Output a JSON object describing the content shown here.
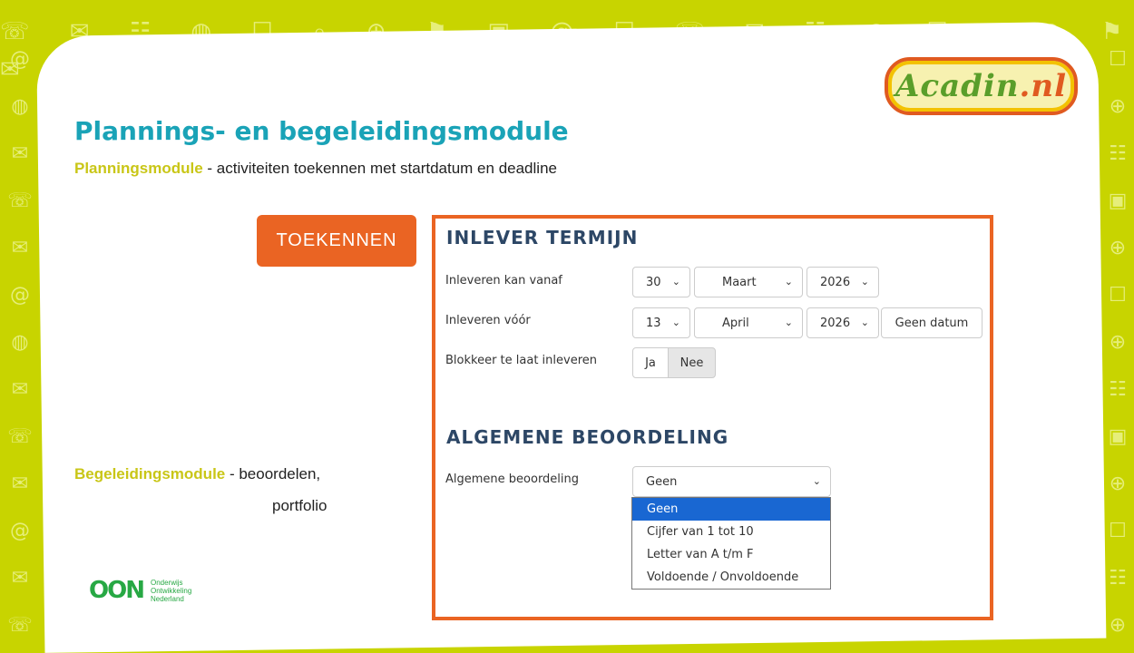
{
  "header": {
    "title": "Plannings- en begeleidingsmodule",
    "subtitle_highlight": "Planningsmodule",
    "subtitle_rest": " - activiteiten toekennen met startdatum en deadline"
  },
  "logo": {
    "main": "Acadin",
    "suffix": ".nl"
  },
  "assign_button": "TOEKENNEN",
  "panel": {
    "deadline_section": {
      "heading": "INLEVER TERMIJN",
      "start": {
        "label": "Inleveren kan vanaf",
        "day": "30",
        "month": "Maart",
        "year": "2026"
      },
      "end": {
        "label": "Inleveren vóór",
        "day": "13",
        "month": "April",
        "year": "2026",
        "no_date_label": "Geen datum"
      },
      "block": {
        "label": "Blokkeer te laat inleveren",
        "yes": "Ja",
        "no": "Nee",
        "selected": "Nee"
      }
    },
    "grading_section": {
      "heading": "ALGEMENE BEOORDELING",
      "label": "Algemene beoordeling",
      "selected": "Geen",
      "options": [
        "Geen",
        "Cijfer van 1 tot 10",
        "Letter van A t/m F",
        "Voldoende / Onvoldoende"
      ]
    }
  },
  "guidance": {
    "highlight": "Begeleidingsmodule",
    "rest": " - beoordelen,",
    "line2": "portfolio"
  },
  "footer_logo": {
    "mark": "OON",
    "lines": [
      "Onderwijs",
      "Ontwikkeling",
      "Nederland"
    ]
  },
  "colors": {
    "accent_orange": "#ea6423",
    "title_teal": "#1aa3b7",
    "highlight_yellow": "#c9c617",
    "background_lime": "#c8d400"
  }
}
